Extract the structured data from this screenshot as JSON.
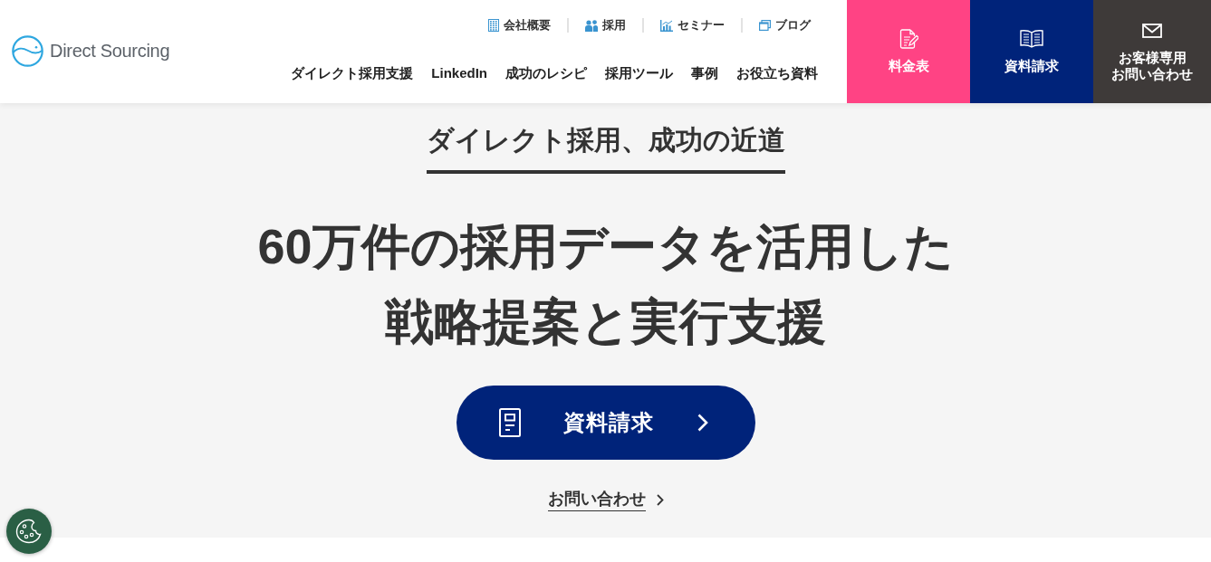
{
  "header": {
    "logo": {
      "text": "Direct Sourcing"
    },
    "utility_links": [
      "会社概要",
      "採用",
      "セミナー",
      "ブログ"
    ],
    "nav": [
      "ダイレクト採用支援",
      "LinkedIn",
      "成功のレシピ",
      "採用ツール",
      "事例",
      "お役立ち資料"
    ],
    "cta_buttons": [
      {
        "lines": [
          "料金表"
        ],
        "color": "#ff4384"
      },
      {
        "lines": [
          "資料請求"
        ],
        "color": "#00237a"
      },
      {
        "lines": [
          "お客様専用",
          "お問い合わせ"
        ],
        "color": "#3e3a39"
      }
    ]
  },
  "hero": {
    "tagline": "ダイレクト採用、成功の近道",
    "heading": [
      "60万件の採用データを活用した",
      "戦略提案と実行支援"
    ],
    "primary_button": "資料請求",
    "secondary_link": "お問い合わせ"
  }
}
